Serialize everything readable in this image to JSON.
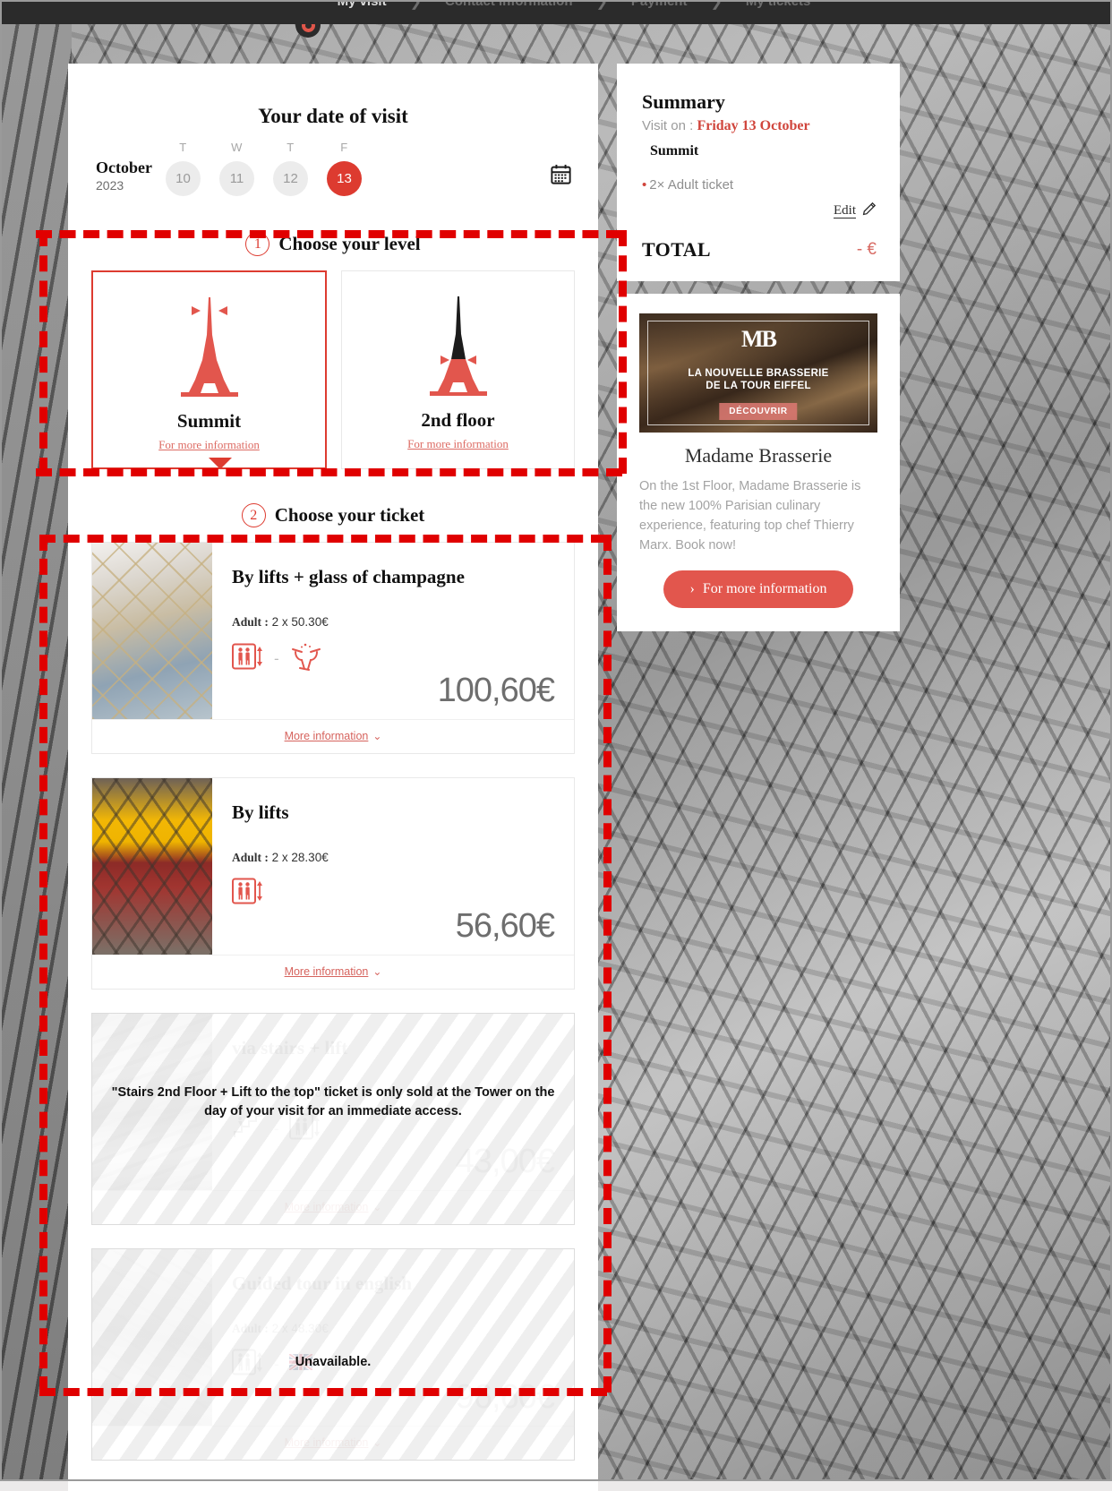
{
  "nav": {
    "steps": [
      {
        "label": "My visit",
        "active": true
      },
      {
        "label": "Contact information",
        "active": false
      },
      {
        "label": "Payment",
        "active": false
      },
      {
        "label": "My tickets",
        "active": false
      }
    ],
    "separator": "❯"
  },
  "date": {
    "title": "Your date of visit",
    "month": "October",
    "year": "2023",
    "days": [
      {
        "dow": "T",
        "num": "10",
        "selected": false
      },
      {
        "dow": "W",
        "num": "11",
        "selected": false
      },
      {
        "dow": "T",
        "num": "12",
        "selected": false
      },
      {
        "dow": "F",
        "num": "13",
        "selected": true
      }
    ],
    "calendar_icon": "calendar-icon"
  },
  "step1": {
    "number": "1",
    "label": "Choose your level",
    "levels": [
      {
        "name": "Summit",
        "more": "For more information",
        "selected": true
      },
      {
        "name": "2nd floor",
        "more": "For more information",
        "selected": false
      }
    ]
  },
  "step2": {
    "number": "2",
    "label": "Choose your ticket",
    "more_information": "More information",
    "chevron": "⌄",
    "tickets": [
      {
        "title": "By lifts + glass of champagne",
        "price_label": "Adult :",
        "price_detail": "2 x 50.30€",
        "total": "100,60€",
        "icons": [
          "lift-icon",
          "plus-separator",
          "champagne-glasses-icon"
        ],
        "separator": "-",
        "disabled": false,
        "overlay": ""
      },
      {
        "title": "By lifts",
        "price_label": "Adult :",
        "price_detail": "2 x 28.30€",
        "total": "56,60€",
        "icons": [
          "lift-icon"
        ],
        "separator": "",
        "disabled": false,
        "overlay": ""
      },
      {
        "title": "via stairs + lift",
        "price_label": "Adult :",
        "price_detail": "2 x 21.50€",
        "total": "43,00€",
        "icons": [
          "stairs-icon",
          "separator",
          "lift-icon"
        ],
        "separator": "-",
        "disabled": true,
        "overlay": "\"Stairs 2nd Floor + Lift to the top\" ticket is only sold at the Tower on the day of your visit for an immediate access."
      },
      {
        "title": "Guided tour in english",
        "price_label": "Adult :",
        "price_detail": "2 x 48.30€",
        "total": "96,60€",
        "icons": [
          "lift-icon",
          "separator",
          "uk-flag-icon"
        ],
        "separator": "-",
        "disabled": true,
        "overlay": "Unavailable."
      }
    ]
  },
  "summary": {
    "heading": "Summary",
    "visit_prefix": "Visit on :",
    "visit_date": "Friday 13 October",
    "level": "Summit",
    "items": [
      "2× Adult ticket"
    ],
    "edit_label": "Edit",
    "edit_icon": "pencil-icon",
    "total_label": "TOTAL",
    "total_value": "- €"
  },
  "promo": {
    "logo": "MB",
    "caption_line1": "LA NOUVELLE BRASSERIE",
    "caption_line2": "DE LA TOUR EIFFEL",
    "cta_badge": "DÉCOUVRIR",
    "title": "Madame Brasserie",
    "body": "On the 1st Floor, Madame Brasserie is the new 100% Parisian culinary experience, featuring top chef Thierry Marx. Book now!",
    "button_label": "For more information",
    "button_chevron": "›"
  },
  "colors": {
    "accent_red": "#dd3b30",
    "promo_button": "#e2564d",
    "annotation_red": "#e00000",
    "muted_grey": "#9a9a9a"
  }
}
